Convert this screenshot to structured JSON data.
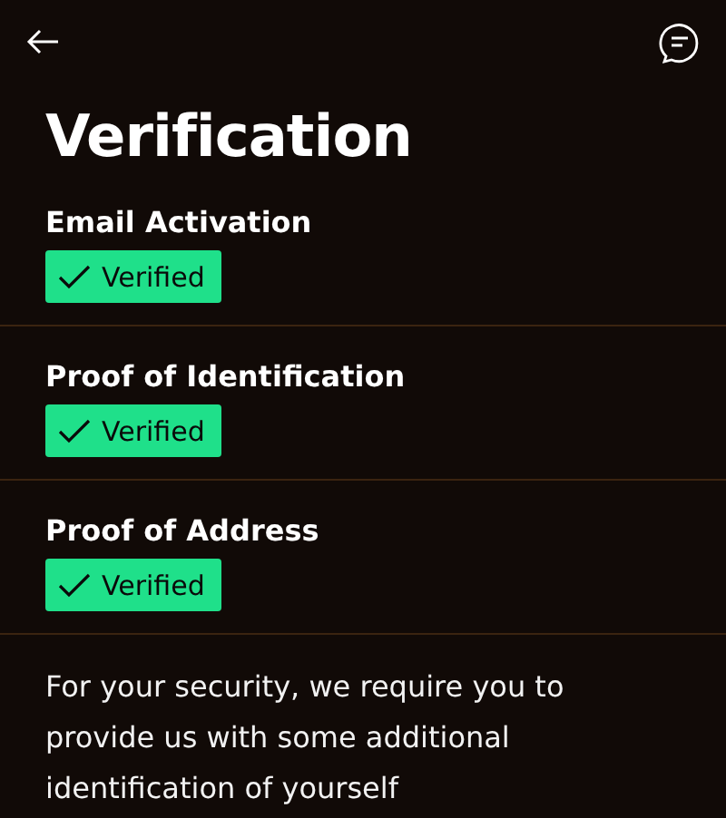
{
  "title": "Verification",
  "items": [
    {
      "label": "Email Activation",
      "status": {
        "kind": "verified",
        "label": "Verified"
      }
    },
    {
      "label": "Proof of Identification",
      "status": {
        "kind": "verified",
        "label": "Verified"
      }
    },
    {
      "label": "Proof of Address",
      "status": {
        "kind": "verified",
        "label": "Verified"
      }
    }
  ],
  "note": "For your security, we require you to provide us with some additional identification of yourself"
}
